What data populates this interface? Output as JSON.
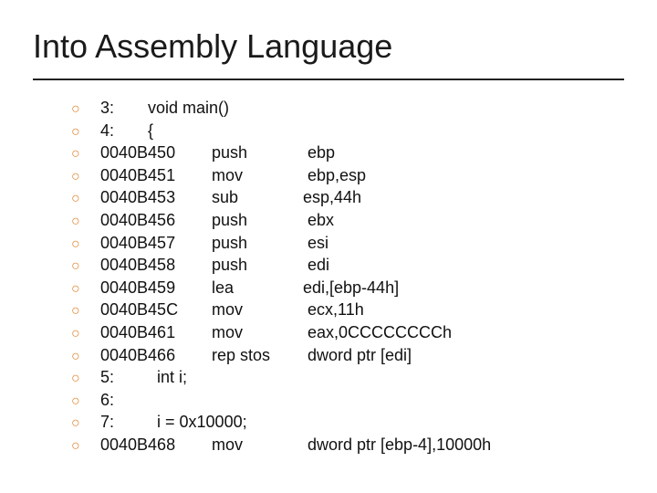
{
  "title": "Into Assembly Language",
  "lines": [
    {
      "type": "src",
      "num": "3:",
      "text": "void main()"
    },
    {
      "type": "src",
      "num": "4:",
      "text": "{"
    },
    {
      "type": "asm",
      "addr": "0040B450",
      "inst": "push",
      "op": " ebp"
    },
    {
      "type": "asm",
      "addr": "0040B451",
      "inst": "mov",
      "op": " ebp,esp"
    },
    {
      "type": "asm",
      "addr": "0040B453",
      "inst": "sub",
      "op": "esp,44h"
    },
    {
      "type": "asm",
      "addr": "0040B456",
      "inst": "push",
      "op": " ebx"
    },
    {
      "type": "asm",
      "addr": "0040B457",
      "inst": "push",
      "op": " esi"
    },
    {
      "type": "asm",
      "addr": "0040B458",
      "inst": "push",
      "op": " edi"
    },
    {
      "type": "asm",
      "addr": "0040B459",
      "inst": "lea",
      "op": "edi,[ebp-44h]"
    },
    {
      "type": "asm",
      "addr": "0040B45C",
      "inst": "mov",
      "op": " ecx,11h"
    },
    {
      "type": "asm",
      "addr": "0040B461",
      "inst": "mov",
      "op": " eax,0CCCCCCCCh"
    },
    {
      "type": "asm",
      "addr": "0040B466",
      "inst": "rep stos",
      "op": " dword ptr [edi]"
    },
    {
      "type": "src2",
      "num": "5:",
      "text": "int i;"
    },
    {
      "type": "src",
      "num": "6:",
      "text": ""
    },
    {
      "type": "src2",
      "num": "7:",
      "text": "i = 0x10000;"
    },
    {
      "type": "asm",
      "addr": "0040B468",
      "inst": "mov",
      "op": " dword ptr [ebp-4],10000h"
    }
  ]
}
